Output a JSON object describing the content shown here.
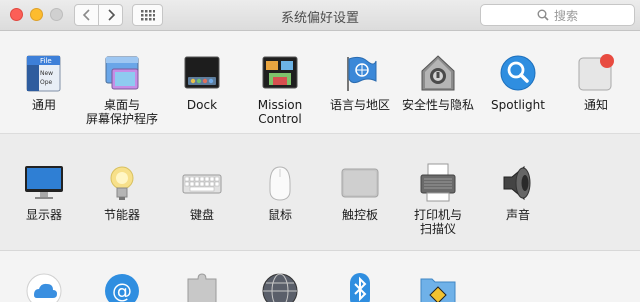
{
  "window": {
    "title": "系统偏好设置",
    "search_placeholder": "搜索"
  },
  "colors": {
    "close": "#fc5f57",
    "minimize": "#fdbc2e",
    "zoom": "#d0d0d0",
    "annotation_arrow": "#e8372c"
  },
  "icons": {
    "back": "chevron-left-icon",
    "forward": "chevron-right-icon",
    "show_all": "grid-icon",
    "search": "magnifier-icon"
  },
  "sections": [
    {
      "name": "personal",
      "panes": [
        {
          "label": "通用",
          "icon": "general-icon",
          "file_text": "File\nNew\nOpe"
        },
        {
          "label": "桌面与\n屏幕保护程序",
          "icon": "desktop-screensaver-icon"
        },
        {
          "label": "Dock",
          "icon": "dock-icon"
        },
        {
          "label": "Mission\nControl",
          "icon": "mission-control-icon"
        },
        {
          "label": "语言与地区",
          "icon": "language-region-icon"
        },
        {
          "label": "安全性与隐私",
          "icon": "security-privacy-icon"
        },
        {
          "label": "Spotlight",
          "icon": "spotlight-icon"
        },
        {
          "label": "通知",
          "icon": "notifications-icon"
        }
      ]
    },
    {
      "name": "hardware",
      "panes": [
        {
          "label": "显示器",
          "icon": "displays-icon"
        },
        {
          "label": "节能器",
          "icon": "energy-saver-icon"
        },
        {
          "label": "键盘",
          "icon": "keyboard-icon"
        },
        {
          "label": "鼠标",
          "icon": "mouse-icon"
        },
        {
          "label": "触控板",
          "icon": "trackpad-icon"
        },
        {
          "label": "打印机与\n扫描仪",
          "icon": "printers-scanners-icon"
        },
        {
          "label": "声音",
          "icon": "sound-icon"
        }
      ]
    },
    {
      "name": "internet",
      "panes": [
        {
          "label": "",
          "icon": "icloud-icon"
        },
        {
          "label": "",
          "icon": "internet-accounts-icon"
        },
        {
          "label": "",
          "icon": "extensions-icon"
        },
        {
          "label": "",
          "icon": "network-icon"
        },
        {
          "label": "",
          "icon": "bluetooth-icon"
        },
        {
          "label": "",
          "icon": "sharing-icon"
        }
      ]
    }
  ]
}
